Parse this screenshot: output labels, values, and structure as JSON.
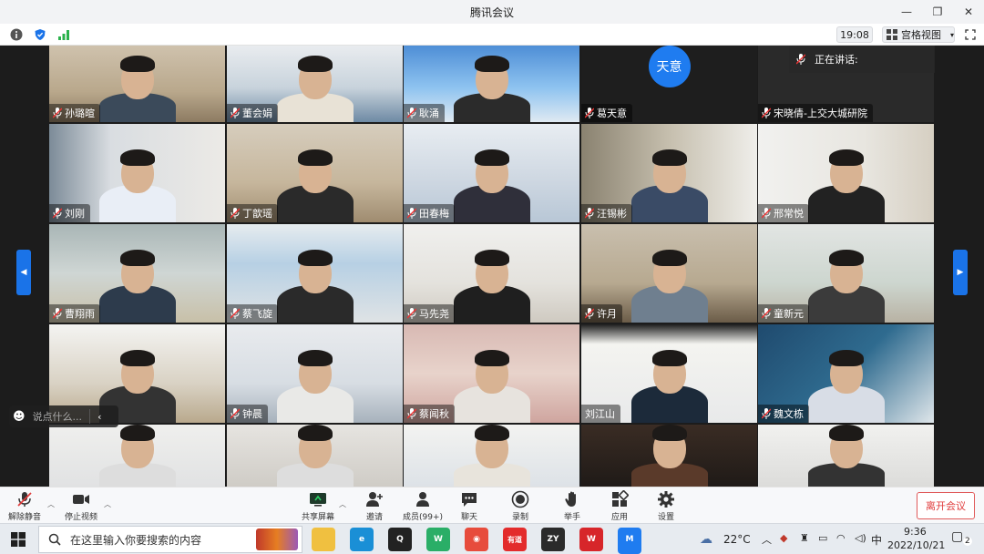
{
  "window": {
    "title": "腾讯会议"
  },
  "infobar": {
    "time": "19:08",
    "view_label": "宫格视图"
  },
  "speaking": {
    "label": "正在讲话:"
  },
  "participants": [
    {
      "name": "孙璐暄",
      "muted": true
    },
    {
      "name": "董会娟",
      "muted": true
    },
    {
      "name": "耿涌",
      "muted": true
    },
    {
      "name": "葛天意",
      "muted": true,
      "avatar": "天意"
    },
    {
      "name": "宋晓倩-上交大城研院",
      "muted": true
    },
    {
      "name": "刘刚",
      "muted": true
    },
    {
      "name": "丁歆瑶",
      "muted": true
    },
    {
      "name": "田春梅",
      "muted": true
    },
    {
      "name": "汪锡彬",
      "muted": true
    },
    {
      "name": "邢常悦",
      "muted": true
    },
    {
      "name": "曹翔雨",
      "muted": true
    },
    {
      "name": "蔡飞旋",
      "muted": true
    },
    {
      "name": "马先尧",
      "muted": true
    },
    {
      "name": "许月",
      "muted": true
    },
    {
      "name": "童新元",
      "muted": true
    },
    {
      "name": "",
      "muted": false
    },
    {
      "name": "钟晨",
      "muted": true
    },
    {
      "name": "蔡闻秋",
      "muted": true
    },
    {
      "name": "刘江山",
      "muted": false
    },
    {
      "name": "魏文栋",
      "muted": true
    },
    {
      "name": "",
      "muted": false
    },
    {
      "name": "",
      "muted": false
    },
    {
      "name": "",
      "muted": false
    },
    {
      "name": "",
      "muted": false
    },
    {
      "name": "",
      "muted": false
    }
  ],
  "chat": {
    "placeholder": "说点什么..."
  },
  "toolbar": {
    "mute": "解除静音",
    "video": "停止视频",
    "share": "共享屏幕",
    "invite": "邀请",
    "members": "成员(99+)",
    "chat": "聊天",
    "record": "录制",
    "raise_hand": "举手",
    "apps": "应用",
    "settings": "设置",
    "leave": "离开会议"
  },
  "taskbar": {
    "search_placeholder": "在这里输入你要搜索的内容",
    "weather": "22°C",
    "ime": "中",
    "clock_time": "9:36",
    "clock_date": "2022/10/21",
    "notifications": "2"
  },
  "colors": {
    "accent": "#1a73e8",
    "avatar": "#1f7cf0",
    "leave": "#e03b3b"
  }
}
